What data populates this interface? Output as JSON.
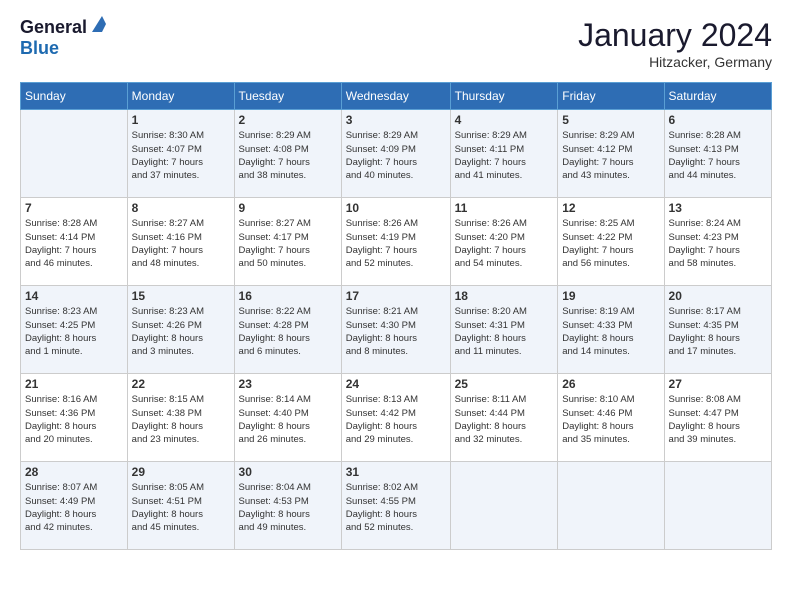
{
  "header": {
    "logo_general": "General",
    "logo_blue": "Blue",
    "title": "January 2024",
    "subtitle": "Hitzacker, Germany"
  },
  "columns": [
    "Sunday",
    "Monday",
    "Tuesday",
    "Wednesday",
    "Thursday",
    "Friday",
    "Saturday"
  ],
  "weeks": [
    [
      {
        "day": "",
        "info": ""
      },
      {
        "day": "1",
        "info": "Sunrise: 8:30 AM\nSunset: 4:07 PM\nDaylight: 7 hours\nand 37 minutes."
      },
      {
        "day": "2",
        "info": "Sunrise: 8:29 AM\nSunset: 4:08 PM\nDaylight: 7 hours\nand 38 minutes."
      },
      {
        "day": "3",
        "info": "Sunrise: 8:29 AM\nSunset: 4:09 PM\nDaylight: 7 hours\nand 40 minutes."
      },
      {
        "day": "4",
        "info": "Sunrise: 8:29 AM\nSunset: 4:11 PM\nDaylight: 7 hours\nand 41 minutes."
      },
      {
        "day": "5",
        "info": "Sunrise: 8:29 AM\nSunset: 4:12 PM\nDaylight: 7 hours\nand 43 minutes."
      },
      {
        "day": "6",
        "info": "Sunrise: 8:28 AM\nSunset: 4:13 PM\nDaylight: 7 hours\nand 44 minutes."
      }
    ],
    [
      {
        "day": "7",
        "info": "Sunrise: 8:28 AM\nSunset: 4:14 PM\nDaylight: 7 hours\nand 46 minutes."
      },
      {
        "day": "8",
        "info": "Sunrise: 8:27 AM\nSunset: 4:16 PM\nDaylight: 7 hours\nand 48 minutes."
      },
      {
        "day": "9",
        "info": "Sunrise: 8:27 AM\nSunset: 4:17 PM\nDaylight: 7 hours\nand 50 minutes."
      },
      {
        "day": "10",
        "info": "Sunrise: 8:26 AM\nSunset: 4:19 PM\nDaylight: 7 hours\nand 52 minutes."
      },
      {
        "day": "11",
        "info": "Sunrise: 8:26 AM\nSunset: 4:20 PM\nDaylight: 7 hours\nand 54 minutes."
      },
      {
        "day": "12",
        "info": "Sunrise: 8:25 AM\nSunset: 4:22 PM\nDaylight: 7 hours\nand 56 minutes."
      },
      {
        "day": "13",
        "info": "Sunrise: 8:24 AM\nSunset: 4:23 PM\nDaylight: 7 hours\nand 58 minutes."
      }
    ],
    [
      {
        "day": "14",
        "info": "Sunrise: 8:23 AM\nSunset: 4:25 PM\nDaylight: 8 hours\nand 1 minute."
      },
      {
        "day": "15",
        "info": "Sunrise: 8:23 AM\nSunset: 4:26 PM\nDaylight: 8 hours\nand 3 minutes."
      },
      {
        "day": "16",
        "info": "Sunrise: 8:22 AM\nSunset: 4:28 PM\nDaylight: 8 hours\nand 6 minutes."
      },
      {
        "day": "17",
        "info": "Sunrise: 8:21 AM\nSunset: 4:30 PM\nDaylight: 8 hours\nand 8 minutes."
      },
      {
        "day": "18",
        "info": "Sunrise: 8:20 AM\nSunset: 4:31 PM\nDaylight: 8 hours\nand 11 minutes."
      },
      {
        "day": "19",
        "info": "Sunrise: 8:19 AM\nSunset: 4:33 PM\nDaylight: 8 hours\nand 14 minutes."
      },
      {
        "day": "20",
        "info": "Sunrise: 8:17 AM\nSunset: 4:35 PM\nDaylight: 8 hours\nand 17 minutes."
      }
    ],
    [
      {
        "day": "21",
        "info": "Sunrise: 8:16 AM\nSunset: 4:36 PM\nDaylight: 8 hours\nand 20 minutes."
      },
      {
        "day": "22",
        "info": "Sunrise: 8:15 AM\nSunset: 4:38 PM\nDaylight: 8 hours\nand 23 minutes."
      },
      {
        "day": "23",
        "info": "Sunrise: 8:14 AM\nSunset: 4:40 PM\nDaylight: 8 hours\nand 26 minutes."
      },
      {
        "day": "24",
        "info": "Sunrise: 8:13 AM\nSunset: 4:42 PM\nDaylight: 8 hours\nand 29 minutes."
      },
      {
        "day": "25",
        "info": "Sunrise: 8:11 AM\nSunset: 4:44 PM\nDaylight: 8 hours\nand 32 minutes."
      },
      {
        "day": "26",
        "info": "Sunrise: 8:10 AM\nSunset: 4:46 PM\nDaylight: 8 hours\nand 35 minutes."
      },
      {
        "day": "27",
        "info": "Sunrise: 8:08 AM\nSunset: 4:47 PM\nDaylight: 8 hours\nand 39 minutes."
      }
    ],
    [
      {
        "day": "28",
        "info": "Sunrise: 8:07 AM\nSunset: 4:49 PM\nDaylight: 8 hours\nand 42 minutes."
      },
      {
        "day": "29",
        "info": "Sunrise: 8:05 AM\nSunset: 4:51 PM\nDaylight: 8 hours\nand 45 minutes."
      },
      {
        "day": "30",
        "info": "Sunrise: 8:04 AM\nSunset: 4:53 PM\nDaylight: 8 hours\nand 49 minutes."
      },
      {
        "day": "31",
        "info": "Sunrise: 8:02 AM\nSunset: 4:55 PM\nDaylight: 8 hours\nand 52 minutes."
      },
      {
        "day": "",
        "info": ""
      },
      {
        "day": "",
        "info": ""
      },
      {
        "day": "",
        "info": ""
      }
    ]
  ]
}
